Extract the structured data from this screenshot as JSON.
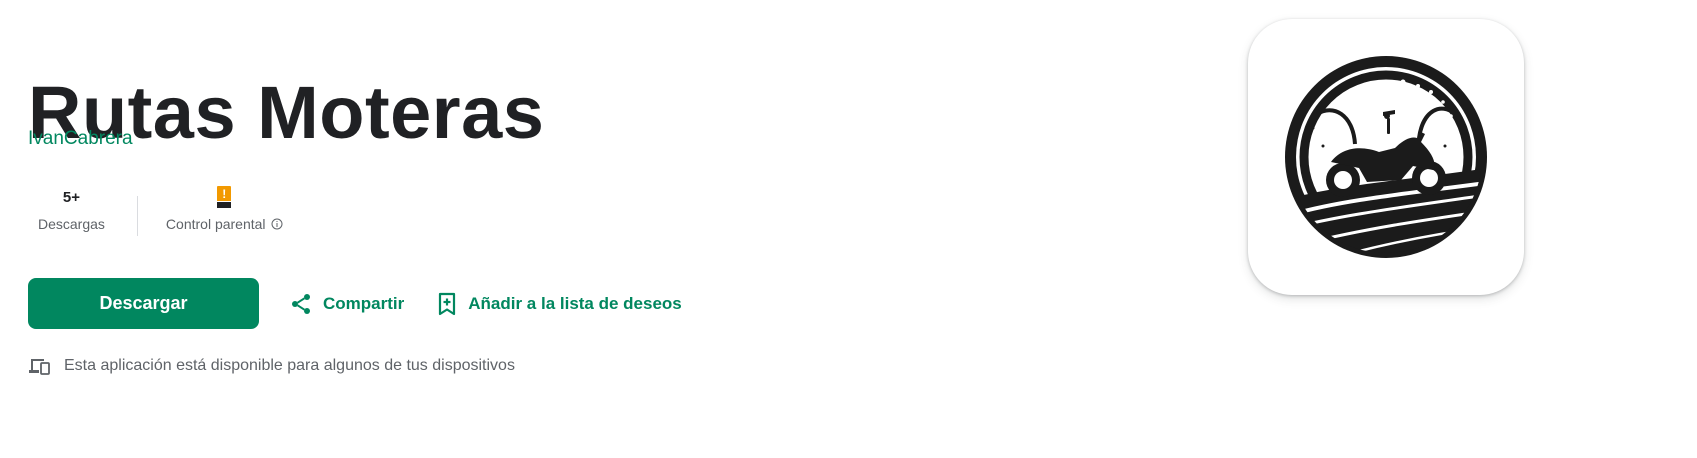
{
  "app": {
    "title": "Rutas Moteras",
    "developer": "IvanCabrera"
  },
  "stats": {
    "downloads": {
      "value": "5+",
      "label": "Descargas"
    },
    "content_rating": {
      "badge": "!",
      "label": "Control parental",
      "info_icon": "info-icon"
    }
  },
  "actions": {
    "install_label": "Descargar",
    "share_label": "Compartir",
    "wishlist_label": "Añadir a la lista de deseos"
  },
  "availability": {
    "text": "Esta aplicación está disponible para algunos de tus dispositivos",
    "icon": "devices-icon"
  },
  "icons": {
    "app_icon": "motorcycle-road-logo-icon",
    "share": "share-icon",
    "wishlist": "bookmark-add-icon"
  },
  "colors": {
    "accent": "#01875f",
    "title": "#202124",
    "secondary_text": "#5f6368",
    "rating_badge": "#f29900"
  }
}
